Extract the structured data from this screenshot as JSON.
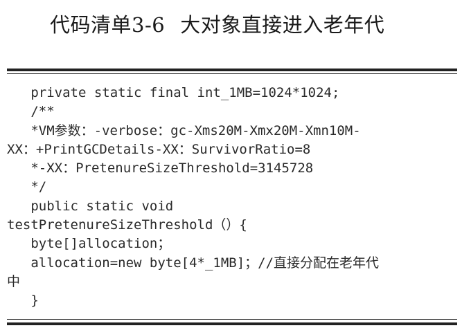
{
  "listing": {
    "number": "代码清单3-6",
    "title": "大对象直接进入老年代"
  },
  "code_lines": [
    "   private static final int_1MB=1024*1024;",
    "   /**",
    "   *VM参数：-verbose：gc-Xms20M-Xmx20M-Xmn10M-",
    "XX：+PrintGCDetails-XX：SurvivorRatio=8",
    "   *-XX：PretenureSizeThreshold=3145728",
    "   */",
    "   public static void",
    "testPretenureSizeThreshold（）{",
    "   byte[]allocation；",
    "   allocation=new byte[4*_1MB]；//直接分配在老年代",
    "中",
    "   }"
  ]
}
